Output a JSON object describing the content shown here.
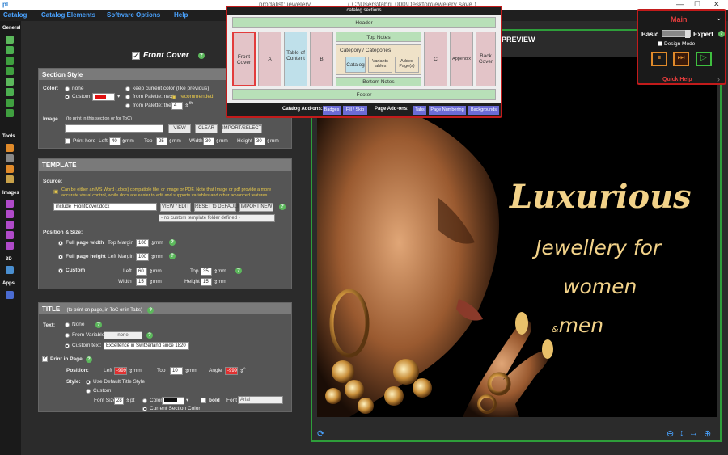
{
  "window": {
    "logo": "pl",
    "app_title": "prodalist: jewelery",
    "path": "( C:\\Users\\fabri_000\\Desktop\\jewelery save )",
    "minimize": "—",
    "maximize": "☐",
    "close": "✕"
  },
  "menu": [
    "Catalog",
    "Catalog Elements",
    "Software Options",
    "Help"
  ],
  "left_toolbar": {
    "groups": [
      "General",
      "Tools",
      "Images",
      "3D",
      "Apps"
    ]
  },
  "front_cover": {
    "title": "Front Cover",
    "checked": true
  },
  "section_style": {
    "header": "Section Style",
    "color_label": "Color:",
    "none": "none",
    "custom": "Custom:",
    "keep": "keep current color (like previous)",
    "palette_next": "from Palette: next",
    "recommended": "recommended",
    "palette_the": "from Palette: the",
    "palette_index": "4",
    "palette_suffix": "th",
    "image_label": "Image",
    "image_hint": "(to print in this section or for ToC)",
    "view": "VIEW",
    "clear": "CLEAR",
    "import": "IMPORT/SELECT",
    "print_here": "Print here",
    "left_lbl": "Left",
    "left_val": "40",
    "top_lbl": "Top",
    "top_val": "25",
    "width_lbl": "Width",
    "width_val": "30",
    "height_lbl": "Height",
    "height_val": "30",
    "mm": "mm"
  },
  "template": {
    "header": "TEMPLATE",
    "source_label": "Source:",
    "info": "Can be either an MS Word (.docx) compatible file, or Image or PDF. Note that Image or pdf provide a more accurate visual control, while docx are easier to edit and supports variables and other advanced features.",
    "file": "include_FrontCover.docx",
    "view_edit": "VIEW / EDIT",
    "reset": "RESET to DEFAULT",
    "import_new": "IMPORT NEW",
    "folder_placeholder": "- no custom template folder defined -",
    "pos_label": "Position & Size:",
    "full_width": "Full page width",
    "top_margin": "Top Margin",
    "top_margin_val": "100",
    "full_height": "Full page height",
    "left_margin": "Left Margin",
    "left_margin_val": "100",
    "custom": "Custom",
    "left_lbl": "Left",
    "left_val": "60",
    "top_lbl": "Top",
    "top_val": "35",
    "width_lbl": "Width",
    "width_val": "15",
    "height_lbl": "Height",
    "height_val": "15",
    "mm": "mm"
  },
  "title_section": {
    "header": "TITLE",
    "header_hint": "(to print on page, in ToC or in Tabs)",
    "text_label": "Text:",
    "none": "None",
    "from_variable": "From Variable",
    "variable_value": "none",
    "custom_text": "Custom text:",
    "custom_value": "Excellence in Switzerland since 1820",
    "print_in_page": "Print in Page",
    "position": "Position:",
    "left_lbl": "Left",
    "left_val": "-999",
    "top_lbl": "Top",
    "top_val": "10",
    "angle_lbl": "Angle",
    "angle_val": "-999",
    "mm": "mm",
    "deg": "°",
    "style_label": "Style:",
    "use_default": "Use Default Title Style",
    "custom_style": "Custom:",
    "font_size_lbl": "Font Size",
    "font_size_val": "28",
    "pt": "pt",
    "color_lbl": "Color",
    "bold": "bold",
    "font_lbl": "Font",
    "font_val": "Arial",
    "current_color": "Current Section Color"
  },
  "preview": {
    "label": "PREVIEW",
    "line1": "Luxurious",
    "line2": "Jewellery for",
    "line3": "women",
    "amp": "&",
    "line4": "men"
  },
  "sections": {
    "title": "catalog sections",
    "header": "Header",
    "front_cover": "Front Cover",
    "a": "A",
    "toc": "Table of Content",
    "b": "B",
    "top_notes": "Top Notes",
    "category": "Category / Categories",
    "catalog": "Catalog",
    "variants": "Variants tables",
    "added": "Added Page(s)",
    "bottom_notes": "Bottom Notes",
    "c": "C",
    "appendix": "Appendix",
    "back_cover": "Back Cover",
    "footer": "Footer",
    "catalog_addons": "Catalog Add-ons:",
    "badges": "Badges",
    "fill_skip": "Fill / Skip",
    "page_addons": "Page Add-ons:",
    "tabs": "Tabs",
    "page_numbering": "Page Numbering",
    "backgrounds": "Backgrounds"
  },
  "mode": {
    "title": "Main",
    "basic": "Basic",
    "expert": "Expert",
    "design_mode": "Design Mode",
    "quick_help": "Quick Help"
  },
  "colors": {
    "accent_blue": "#4aa3ff",
    "accent_red": "#c21b1b",
    "preview_border": "#2e9e3a",
    "gold_text": "#f2d289",
    "help_green": "#5cb85c"
  }
}
